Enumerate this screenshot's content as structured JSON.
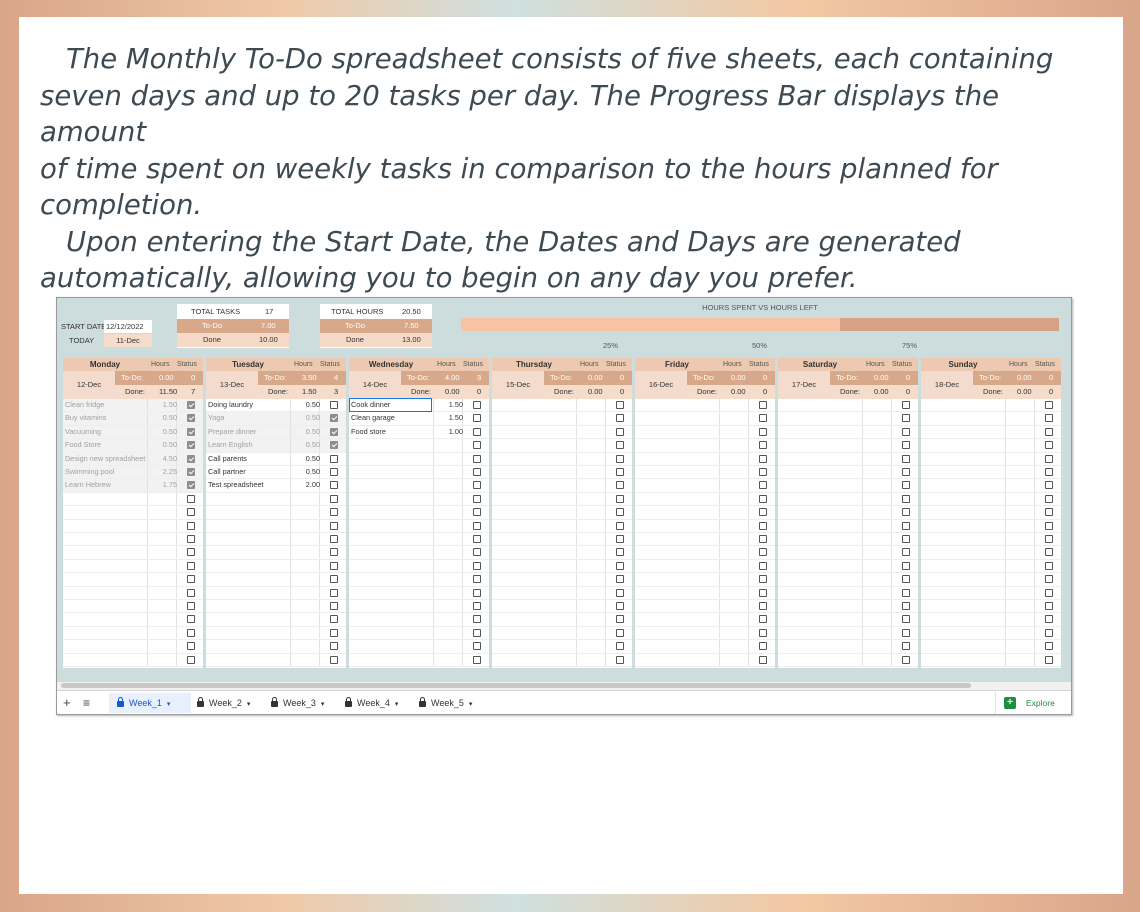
{
  "intro": {
    "line1": "The Monthly To-Do spreadsheet consists of five sheets, each containing",
    "line2": "seven days and up to 20 tasks per day. The Progress Bar displays the amount",
    "line3": "of time spent on weekly tasks in comparison to the hours planned for",
    "line4": "completion.",
    "line5": "Upon entering the Start Date, the Dates and Days are generated",
    "line6": "automatically, allowing you to begin on any day you prefer."
  },
  "summary": {
    "start_date_label": "START DATE",
    "start_date_value": "12/12/2022",
    "today_label": "TODAY",
    "today_value": "11-Dec",
    "total_tasks_label": "TOTAL TASKS",
    "total_tasks_value": "17",
    "tasks_todo_label": "To-Do",
    "tasks_todo_value": "7.00",
    "tasks_done_label": "Done",
    "tasks_done_value": "10.00",
    "total_hours_label": "TOTAL HOURS",
    "total_hours_value": "20.50",
    "hours_todo_label": "To-Do",
    "hours_todo_value": "7.50",
    "hours_done_label": "Done",
    "hours_done_value": "13.00"
  },
  "progress": {
    "title": "HOURS SPENT VS HOURS LEFT",
    "fraction_spent": 0.634,
    "mark_25": "25%",
    "mark_50": "50%",
    "mark_75": "75%"
  },
  "labels": {
    "hours": "Hours",
    "status": "Status",
    "todo": "To-Do:",
    "done": "Done:"
  },
  "days": [
    {
      "name": "Monday",
      "date": "12-Dec",
      "todo_hours": "0.00",
      "todo_count": "0",
      "done_hours": "11.50",
      "done_count": "7",
      "tasks": [
        {
          "name": "Clean fridge",
          "hours": "1.50",
          "done": true
        },
        {
          "name": "Buy vitamins",
          "hours": "0.50",
          "done": true
        },
        {
          "name": "Vacuuming",
          "hours": "0.50",
          "done": true
        },
        {
          "name": "Food Store",
          "hours": "0.50",
          "done": true
        },
        {
          "name": "Design new spreadsheet",
          "hours": "4.50",
          "done": true
        },
        {
          "name": "Swimming pool",
          "hours": "2.25",
          "done": true
        },
        {
          "name": "Learn Hebrew",
          "hours": "1.75",
          "done": true
        }
      ]
    },
    {
      "name": "Tuesday",
      "date": "13-Dec",
      "todo_hours": "3.50",
      "todo_count": "4",
      "done_hours": "1.50",
      "done_count": "3",
      "tasks": [
        {
          "name": "Doing laundry",
          "hours": "0.50",
          "done": false
        },
        {
          "name": "Yoga",
          "hours": "0.50",
          "done": true
        },
        {
          "name": "Prepare dinner",
          "hours": "0.50",
          "done": true
        },
        {
          "name": "Learn English",
          "hours": "0.50",
          "done": true
        },
        {
          "name": "Call parents",
          "hours": "0.50",
          "done": false
        },
        {
          "name": "Call partner",
          "hours": "0.50",
          "done": false
        },
        {
          "name": "Test spreadsheet",
          "hours": "2.00",
          "done": false
        }
      ]
    },
    {
      "name": "Wednesday",
      "date": "14-Dec",
      "todo_hours": "4.00",
      "todo_count": "3",
      "done_hours": "0.00",
      "done_count": "0",
      "tasks": [
        {
          "name": "Cook dinner",
          "hours": "1.50",
          "done": false
        },
        {
          "name": "Clean garage",
          "hours": "1.50",
          "done": false
        },
        {
          "name": "Food store",
          "hours": "1.00",
          "done": false
        }
      ]
    },
    {
      "name": "Thursday",
      "date": "15-Dec",
      "todo_hours": "0.00",
      "todo_count": "0",
      "done_hours": "0.00",
      "done_count": "0",
      "tasks": []
    },
    {
      "name": "Friday",
      "date": "16-Dec",
      "todo_hours": "0.00",
      "todo_count": "0",
      "done_hours": "0.00",
      "done_count": "0",
      "tasks": []
    },
    {
      "name": "Saturday",
      "date": "17-Dec",
      "todo_hours": "0.00",
      "todo_count": "0",
      "done_hours": "0.00",
      "done_count": "0",
      "tasks": []
    },
    {
      "name": "Sunday",
      "date": "18-Dec",
      "todo_hours": "0.00",
      "todo_count": "0",
      "done_hours": "0.00",
      "done_count": "0",
      "tasks": []
    }
  ],
  "tabs": [
    {
      "label": "Week_1",
      "active": true
    },
    {
      "label": "Week_2",
      "active": false
    },
    {
      "label": "Week_3",
      "active": false
    },
    {
      "label": "Week_4",
      "active": false
    },
    {
      "label": "Week_5",
      "active": false
    }
  ],
  "toolbar": {
    "add_label": "+",
    "sheets_label": "≡",
    "explore_label": "Explore"
  },
  "colors": {
    "sheet_bg": "#cddcdc",
    "todo_bar": "#d8a88a",
    "progress_spent": "#f6c3a4",
    "progress_left": "#d5a285",
    "explore_icon": "#1e8e3e"
  }
}
